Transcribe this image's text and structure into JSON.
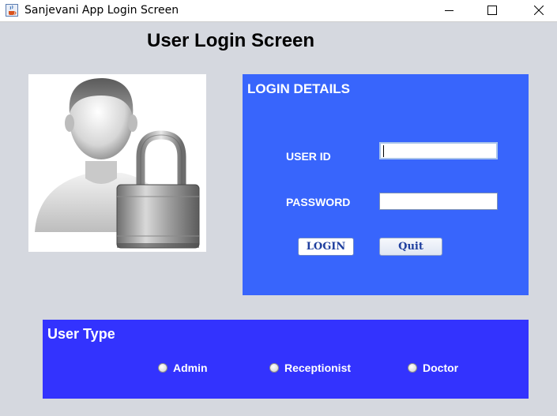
{
  "window": {
    "title": "Sanjevani App Login Screen",
    "icon": "java-cup-icon",
    "controls": [
      "minimize-icon",
      "maximize-icon",
      "close-icon"
    ]
  },
  "heading": "User Login Screen",
  "avatar": {
    "icon": "user-lock-icon"
  },
  "login_panel": {
    "title": "LOGIN DETAILS",
    "user_id_label": "USER ID",
    "user_id_value": "",
    "password_label": "PASSWORD",
    "password_value": "",
    "login_button": "LOGIN",
    "quit_button": "Quit",
    "background": "#3865fc"
  },
  "user_type": {
    "title": "User Type",
    "options": [
      "Admin",
      "Receptionist",
      "Doctor"
    ],
    "selected": null,
    "background": "#3333fe"
  }
}
